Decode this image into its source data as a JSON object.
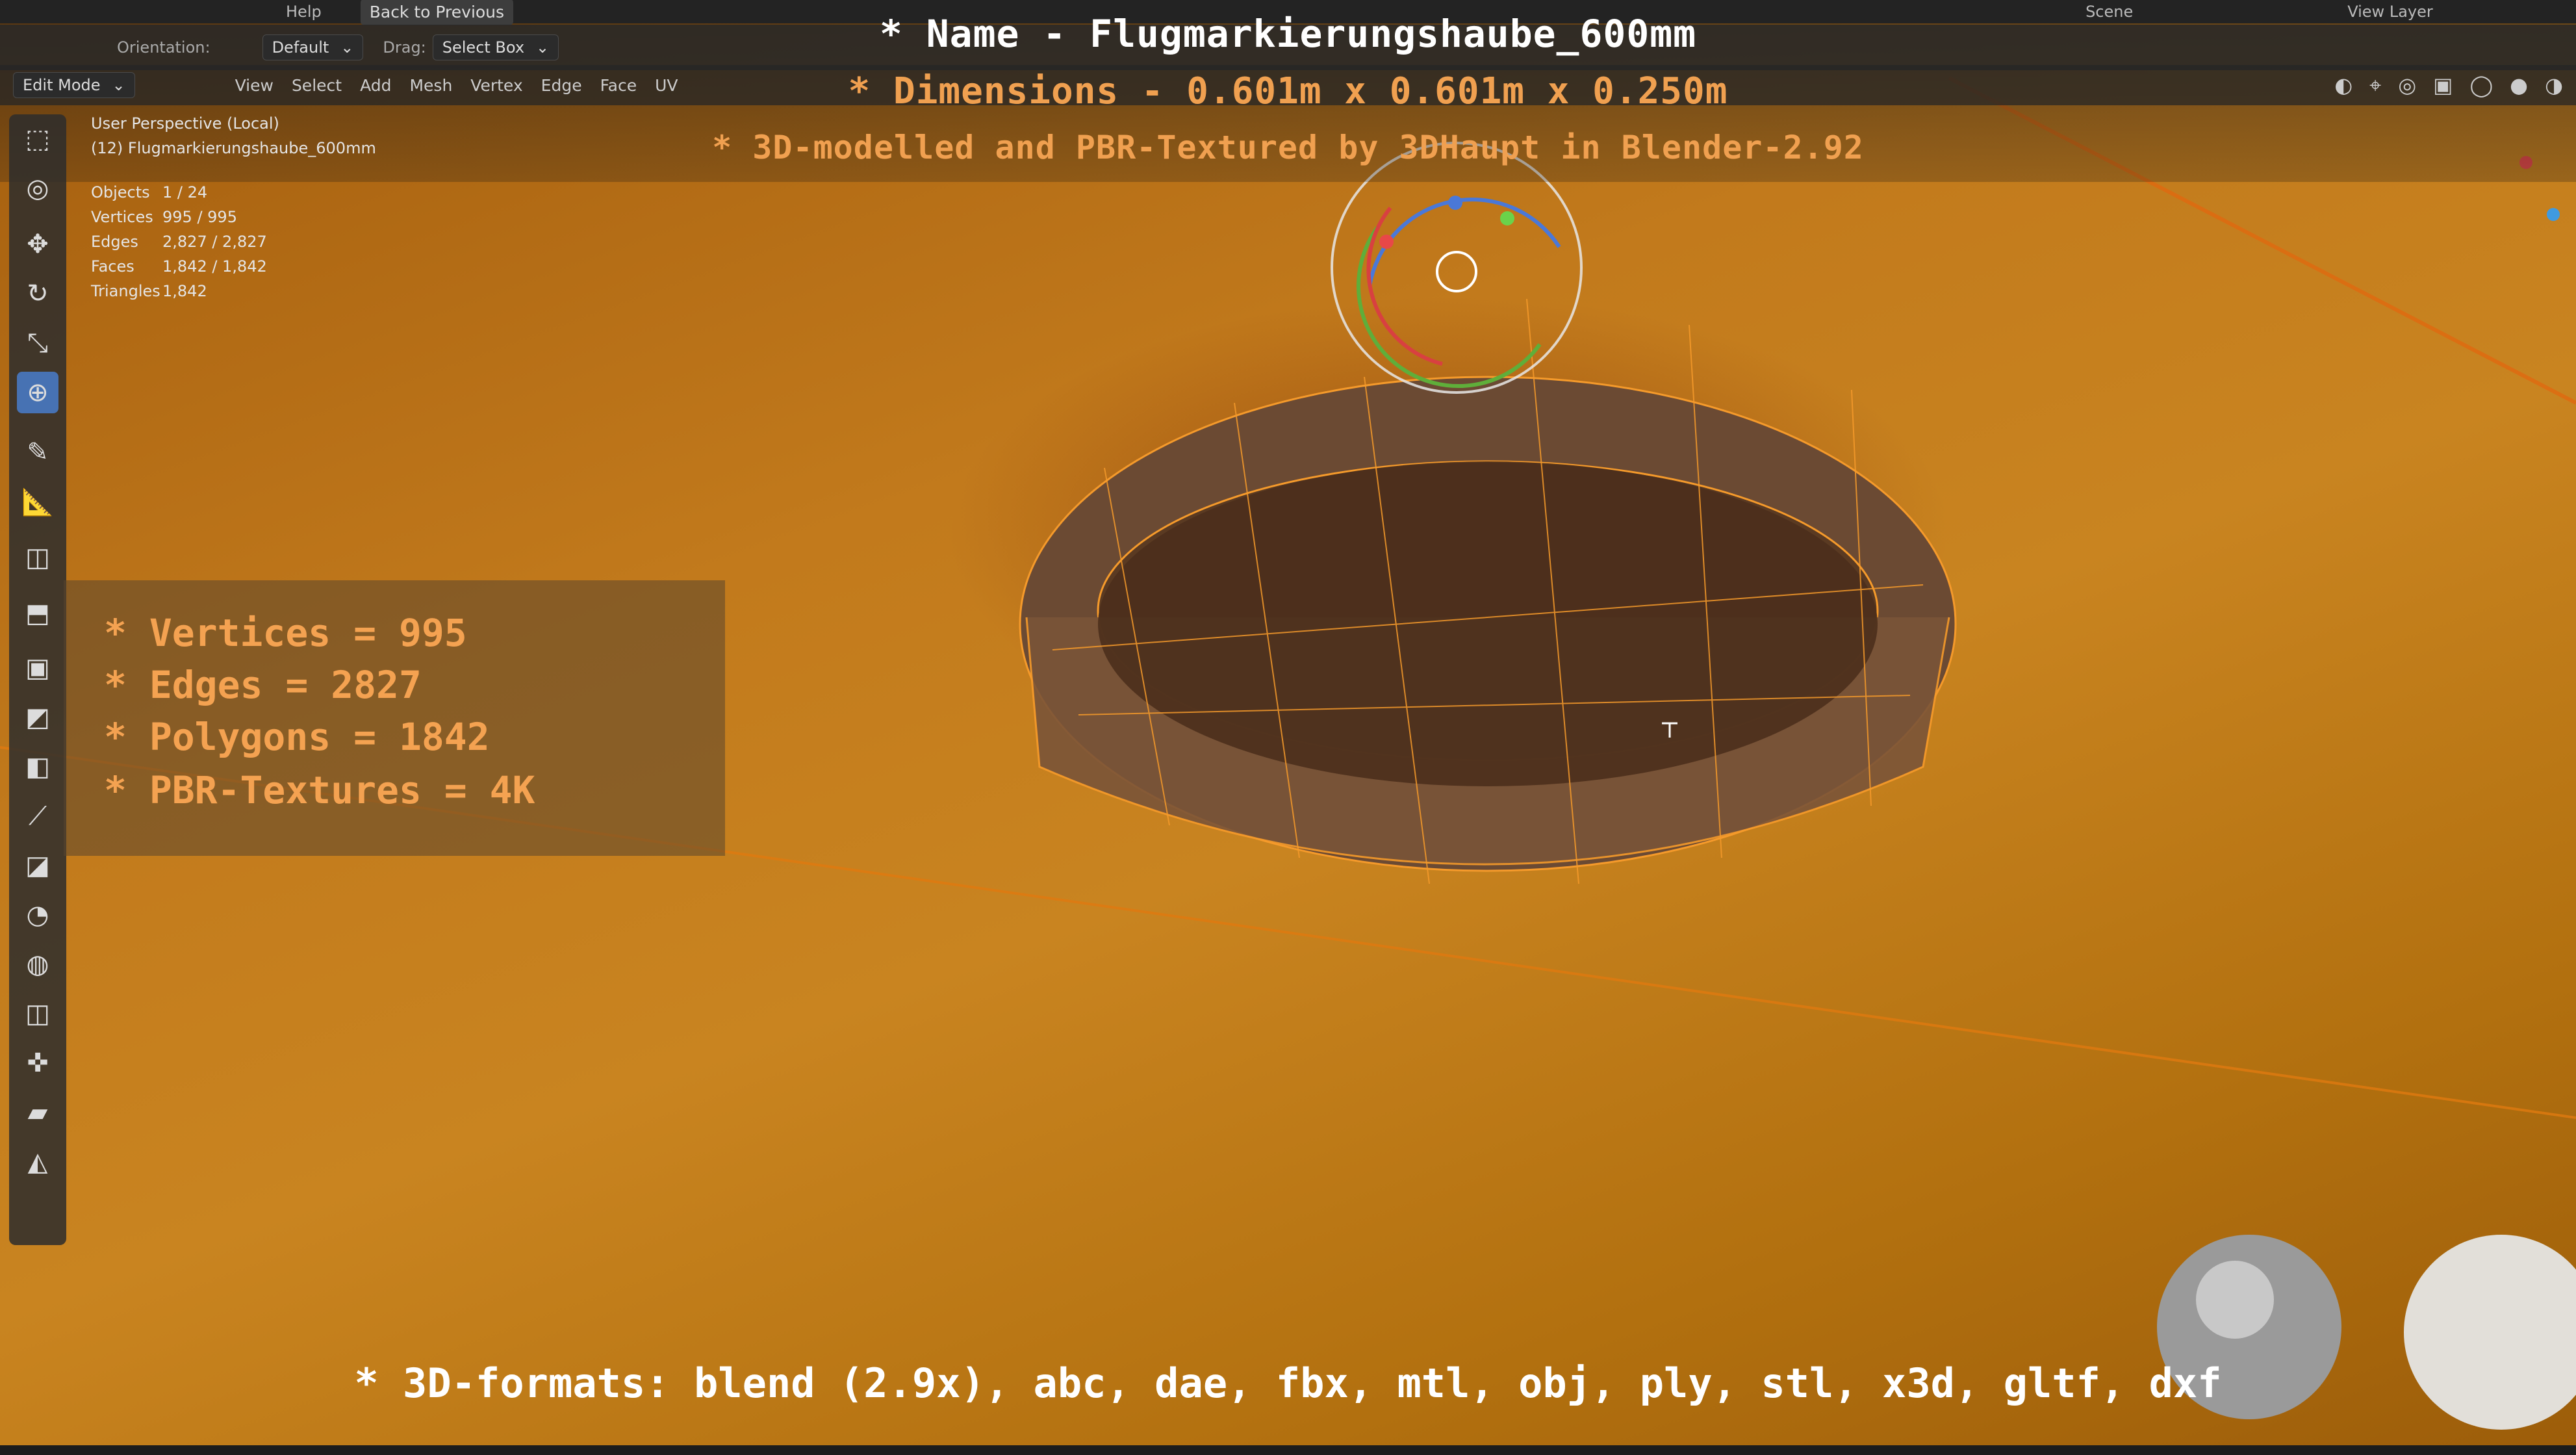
{
  "overlay": {
    "title": "* Name - Flugmarkierungshaube_600mm",
    "dimensions": "* Dimensions -  0.601m x 0.601m x 0.250m",
    "credit": "* 3D-modelled and PBR-Textured by 3DHaupt in Blender-2.92",
    "stats": [
      "* Vertices = 995",
      "* Edges = 2827",
      "* Polygons = 1842",
      "* PBR-Textures = 4K"
    ],
    "formats": "* 3D-formats: blend (2.9x), abc, dae, fbx, mtl, obj, ply, stl, x3d, gltf, dxf"
  },
  "topbar": {
    "menu": [
      "Help"
    ],
    "back_button": "Back to Previous",
    "scene_label": "Scene",
    "view_layer_label": "View Layer"
  },
  "header": {
    "orientation_label": "Orientation:",
    "orientation_value": "Default",
    "drag_label": "Drag:",
    "drag_value": "Select Box",
    "mode": "Edit Mode",
    "menus": [
      "View",
      "Select",
      "Add",
      "Mesh",
      "Vertex",
      "Edge",
      "Face",
      "UV"
    ]
  },
  "viewport_info": {
    "perspective": "User Perspective (Local)",
    "object": "(12) Flugmarkierungshaube_600mm",
    "rows": [
      {
        "key": "Objects",
        "value": "1 / 24"
      },
      {
        "key": "Vertices",
        "value": "995 / 995"
      },
      {
        "key": "Edges",
        "value": "2,827 / 2,827"
      },
      {
        "key": "Faces",
        "value": "1,842 / 1,842"
      },
      {
        "key": "Triangles",
        "value": "1,842"
      }
    ]
  },
  "toolbar_icons": [
    "select-box-icon",
    "cursor-icon",
    "move-icon",
    "rotate-icon",
    "scale-icon",
    "transform-icon",
    "annotate-icon",
    "measure-icon",
    "add-cube-icon",
    "extrude-icon",
    "inset-icon",
    "bevel-icon",
    "loop-cut-icon",
    "knife-icon",
    "poly-build-icon",
    "spin-icon",
    "smooth-icon",
    "edge-slide-icon",
    "shrink-fatten-icon",
    "shear-icon",
    "rip-icon"
  ],
  "colors": {
    "accent": "#4772b3",
    "overlay_orange": "#f0a050",
    "wire": "#f59a2b"
  }
}
